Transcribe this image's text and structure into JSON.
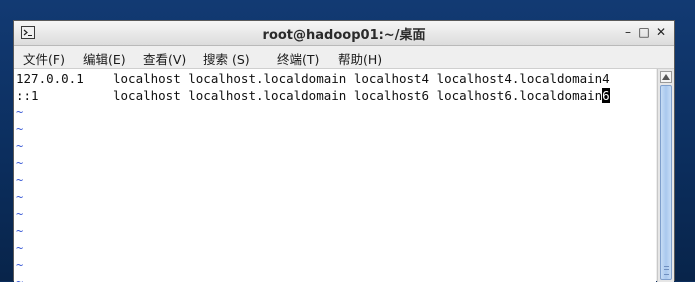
{
  "window": {
    "title": "root@hadoop01:~/桌面",
    "controls": {
      "minimize": "–",
      "maximize": "□",
      "close": "✕"
    }
  },
  "menu": [
    {
      "label": "文件(F)"
    },
    {
      "label": "编辑(E)"
    },
    {
      "label": "查看(V)"
    },
    {
      "label": "搜索 (S)"
    },
    {
      "label": "终端(T)"
    },
    {
      "label": "帮助(H)"
    }
  ],
  "terminal": {
    "lines": [
      {
        "ip": "127.0.0.1",
        "hosts": "localhost localhost.localdomain localhost4 localhost4.localdomain4"
      },
      {
        "ip": "::1",
        "hosts": "localhost localhost.localdomain localhost6 localhost6.localdomain",
        "cursor_char": "6"
      }
    ],
    "tilde": "~"
  },
  "colors": {
    "tilde": "#3b5bd6",
    "cursor_bg": "#000000"
  },
  "icons": {
    "app": "terminal-icon",
    "scroll_up": "arrow-up-icon"
  }
}
